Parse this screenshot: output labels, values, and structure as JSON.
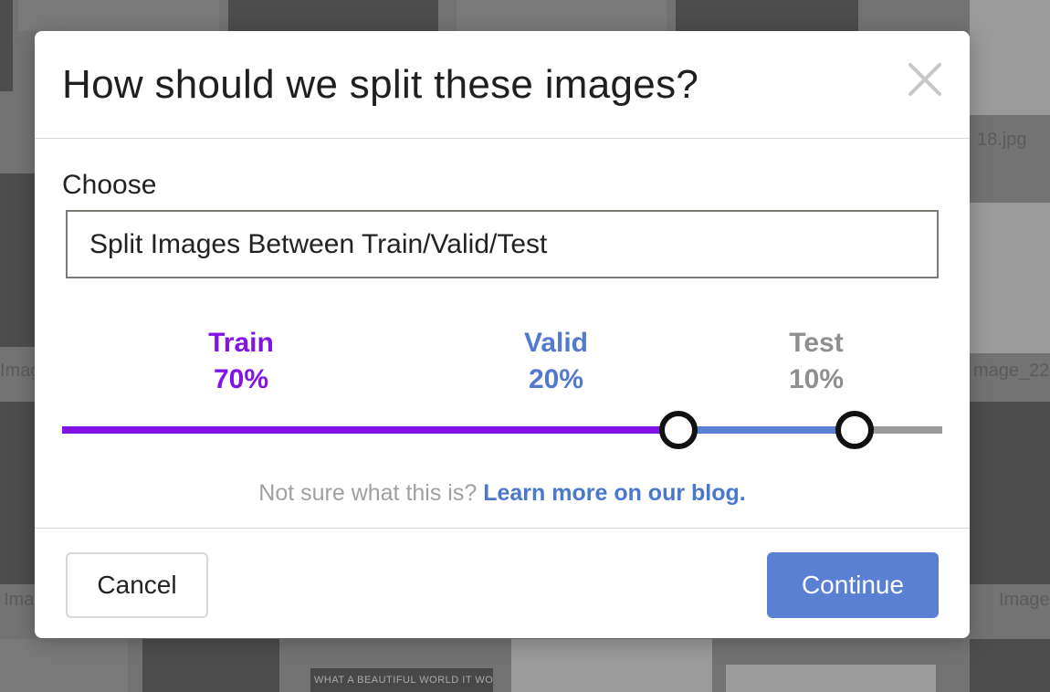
{
  "background": {
    "captions": [
      "18.jpg",
      "Imag",
      "mage_22",
      "Ima",
      "Image"
    ],
    "poster_text": "WHAT A BEAUTIFUL WORLD IT WOULD BE IF..."
  },
  "modal": {
    "title": "How should we split these images?",
    "close_icon": "close-icon",
    "choose_label": "Choose",
    "selected_option": "Split Images Between Train/Valid/Test",
    "splits": [
      {
        "name": "Train",
        "percent_label": "70%",
        "value": 70,
        "color": "#8313e4"
      },
      {
        "name": "Valid",
        "percent_label": "20%",
        "value": 20,
        "color": "#5279d0"
      },
      {
        "name": "Test",
        "percent_label": "10%",
        "value": 10,
        "color": "#8f8f8f"
      }
    ],
    "help_text": "Not sure what this is?",
    "help_link": "Learn more on our blog.",
    "cancel_label": "Cancel",
    "continue_label": "Continue"
  }
}
